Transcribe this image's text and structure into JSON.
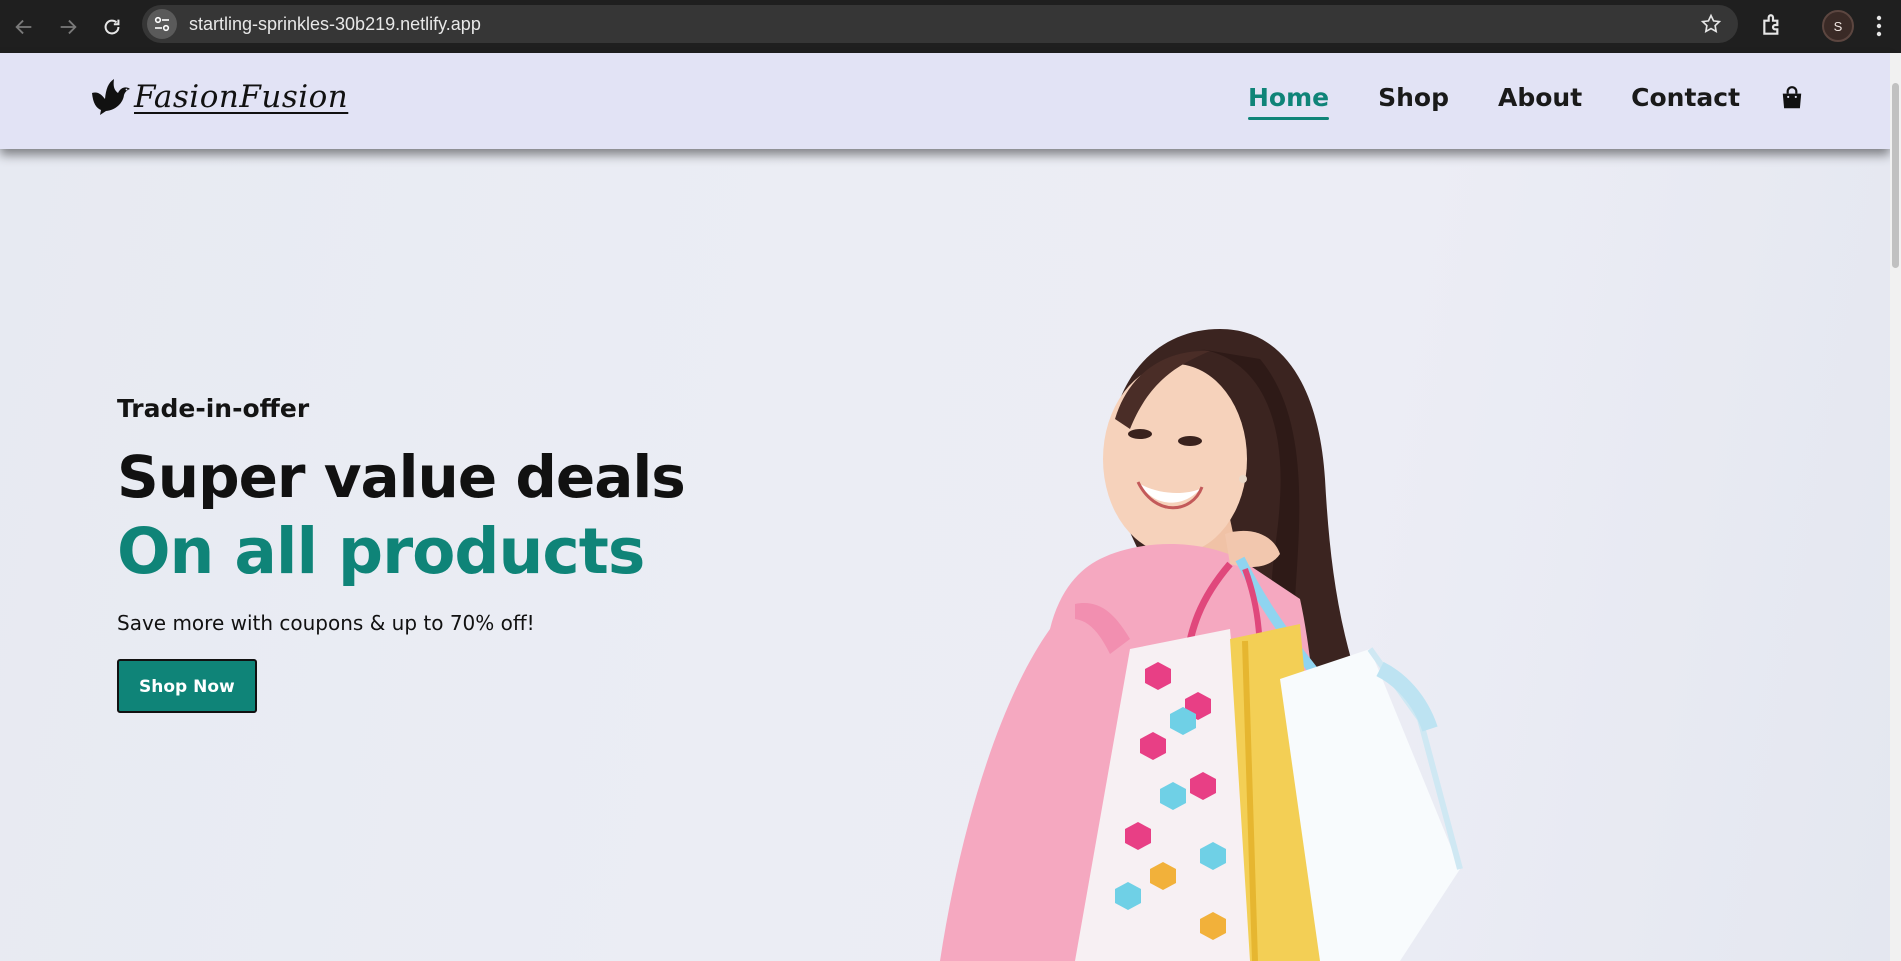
{
  "browser": {
    "url": "startling-sprinkles-30b219.netlify.app",
    "profile_initial": "S",
    "icons": [
      "back-arrow-icon",
      "forward-arrow-icon",
      "reload-icon",
      "site-settings-icon",
      "bookmark-star-icon",
      "extensions-icon",
      "more-menu-icon"
    ]
  },
  "header": {
    "logo_text": "FasionFusion",
    "nav": [
      {
        "label": "Home",
        "active": true
      },
      {
        "label": "Shop",
        "active": false
      },
      {
        "label": "About",
        "active": false
      },
      {
        "label": "Contact",
        "active": false
      }
    ],
    "cart_icon": "shopping-bag-icon"
  },
  "hero": {
    "kicker": "Trade-in-offer",
    "headline": "Super value deals",
    "headline_accent": "On all products",
    "subtext": "Save more with coupons & up to 70% off!",
    "cta_label": "Shop Now"
  },
  "colors": {
    "accent": "#0f8478",
    "header_bg": "#e2e3f5",
    "hero_bg": "#e9ecf3",
    "chrome_bg": "#1f1f1f"
  }
}
